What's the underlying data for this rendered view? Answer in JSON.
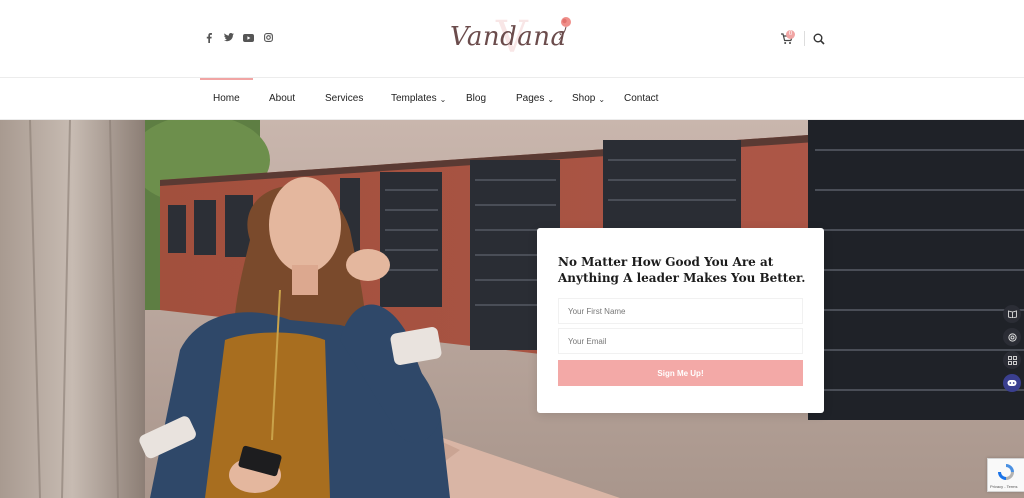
{
  "header": {
    "logo_text": "Vandana",
    "social_icons": [
      "facebook-icon",
      "twitter-icon",
      "youtube-icon",
      "instagram-icon"
    ],
    "cart_count": "0"
  },
  "nav": {
    "items": [
      {
        "label": "Home",
        "active": true
      },
      {
        "label": "About"
      },
      {
        "label": "Services"
      },
      {
        "label": "Templates",
        "dropdown": true
      },
      {
        "label": "Blog"
      },
      {
        "label": "Pages",
        "dropdown": true
      },
      {
        "label": "Shop",
        "dropdown": true
      },
      {
        "label": "Contact"
      }
    ]
  },
  "hero": {
    "card": {
      "title": "No Matter How Good You Are at Anything A leader Makes You Better.",
      "first_name_placeholder": "Your First Name",
      "email_placeholder": "Your Email",
      "button_label": "Sign Me Up!"
    }
  },
  "recaptcha": {
    "text": "Privacy - Terms"
  },
  "colors": {
    "accent": "#f3a9a7",
    "brand_text": "#6b4c4c"
  }
}
